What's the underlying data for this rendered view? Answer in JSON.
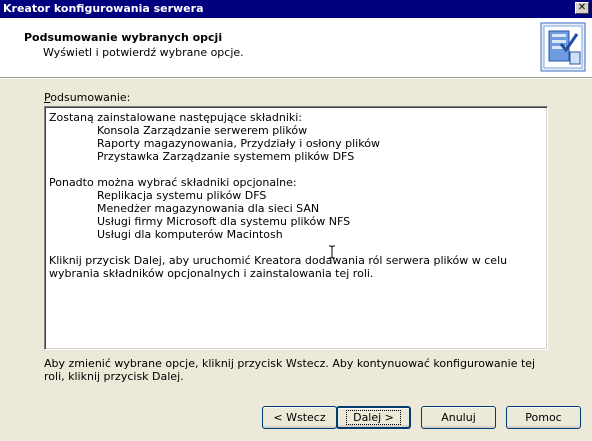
{
  "window": {
    "title": "Kreator konfigurowania serwera",
    "close_label": "✕"
  },
  "header": {
    "title": "Podsumowanie wybranych opcji",
    "subtitle": "Wyświetl i potwierdź wybrane opcje."
  },
  "summary": {
    "label_accel": "P",
    "label_rest": "odsumowanie:",
    "section1_heading": "Zostaną zainstalowane następujące składniki:",
    "section1_items": [
      "Konsola Zarządzanie serwerem plików",
      "Raporty magazynowania, Przydziały i osłony plików",
      "Przystawka Zarządzanie systemem plików DFS"
    ],
    "section2_heading": "Ponadto można wybrać składniki opcjonalne:",
    "section2_items": [
      "Replikacja systemu plików DFS",
      "Menedżer magazynowania dla sieci SAN",
      "Usługi firmy Microsoft dla systemu plików NFS",
      "Usługi dla komputerów Macintosh"
    ],
    "closing_text": "Kliknij przycisk Dalej, aby uruchomić Kreatora dodawania ról serwera plików w celu wybrania składników opcjonalnych i zainstalowania tej roli."
  },
  "footer": {
    "instructions": "Aby zmienić wybrane opcje, kliknij przycisk Wstecz. Aby kontynuować konfigurowanie tej roli, kliknij przycisk Dalej."
  },
  "buttons": {
    "back_label": "< Wstecz",
    "next_label": "Dalej >",
    "cancel_label": "Anuluj",
    "help_label": "Pomoc"
  }
}
